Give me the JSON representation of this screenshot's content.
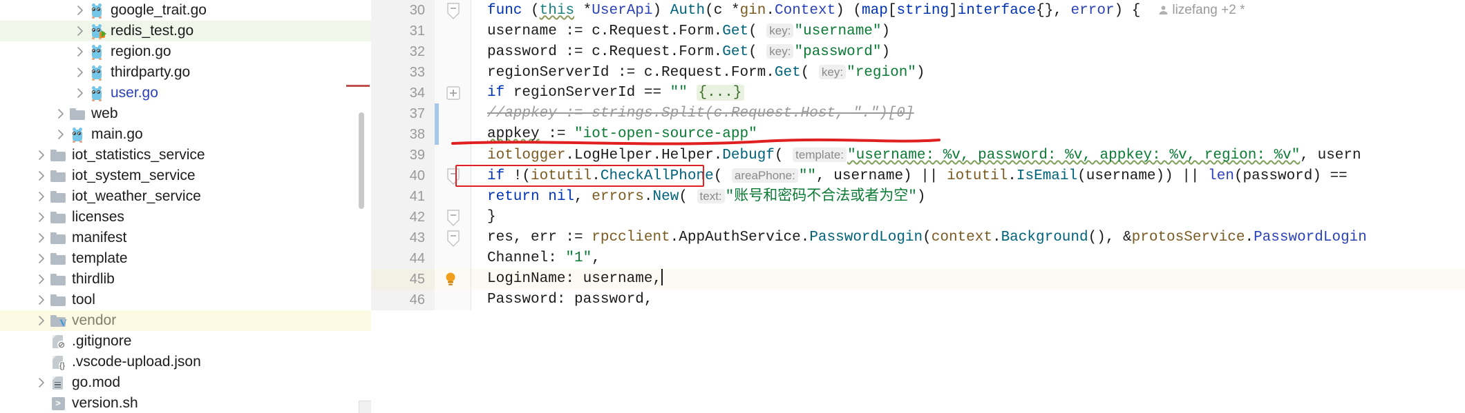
{
  "app": {
    "kind": "goland-ide-code-editor"
  },
  "sidebar": {
    "name": "project-file-tree",
    "scrollbar": {
      "name": "vertical-scrollbar"
    },
    "items": [
      {
        "label": "google_trait.go",
        "icon": "go-file-icon",
        "indent": 3,
        "arrow": true,
        "state": "normal"
      },
      {
        "label": "redis_test.go",
        "icon": "go-test-file-icon",
        "indent": 3,
        "arrow": true,
        "state": "highlight-green"
      },
      {
        "label": "region.go",
        "icon": "go-file-icon",
        "indent": 3,
        "arrow": true,
        "state": "normal"
      },
      {
        "label": "thirdparty.go",
        "icon": "go-file-icon",
        "indent": 3,
        "arrow": true,
        "state": "normal"
      },
      {
        "label": "user.go",
        "icon": "go-file-icon",
        "indent": 3,
        "arrow": true,
        "state": "open-file"
      },
      {
        "label": "web",
        "icon": "folder-icon",
        "indent": 2,
        "arrow": true,
        "state": "normal"
      },
      {
        "label": "main.go",
        "icon": "go-file-icon",
        "indent": 2,
        "arrow": true,
        "state": "normal"
      },
      {
        "label": "iot_statistics_service",
        "icon": "folder-icon",
        "indent": 1,
        "arrow": true,
        "state": "normal"
      },
      {
        "label": "iot_system_service",
        "icon": "folder-icon",
        "indent": 1,
        "arrow": true,
        "state": "normal"
      },
      {
        "label": "iot_weather_service",
        "icon": "folder-icon",
        "indent": 1,
        "arrow": true,
        "state": "normal"
      },
      {
        "label": "licenses",
        "icon": "folder-icon",
        "indent": 1,
        "arrow": true,
        "state": "normal"
      },
      {
        "label": "manifest",
        "icon": "folder-icon",
        "indent": 1,
        "arrow": true,
        "state": "normal"
      },
      {
        "label": "template",
        "icon": "folder-icon",
        "indent": 1,
        "arrow": true,
        "state": "normal"
      },
      {
        "label": "thirdlib",
        "icon": "folder-icon",
        "indent": 1,
        "arrow": true,
        "state": "normal"
      },
      {
        "label": "tool",
        "icon": "folder-icon",
        "indent": 1,
        "arrow": true,
        "state": "normal"
      },
      {
        "label": "vendor",
        "icon": "vendor-folder-icon",
        "indent": 1,
        "arrow": true,
        "state": "highlight-yellow"
      },
      {
        "label": ".gitignore",
        "icon": "gitignore-file-icon",
        "indent": 1,
        "arrow": false,
        "state": "normal"
      },
      {
        "label": ".vscode-upload.json",
        "icon": "json-file-icon",
        "indent": 1,
        "arrow": false,
        "state": "normal"
      },
      {
        "label": "go.mod",
        "icon": "gomod-file-icon",
        "indent": 1,
        "arrow": true,
        "state": "normal"
      },
      {
        "label": "version.sh",
        "icon": "shell-file-icon",
        "indent": 1,
        "arrow": false,
        "state": "normal"
      }
    ]
  },
  "editor": {
    "author_annotation": "lizefang +2 *",
    "cursor_line": 45,
    "lines": [
      {
        "num": "30",
        "fold": "minus",
        "change": false,
        "bulb": false
      },
      {
        "num": "31",
        "fold": null,
        "change": false,
        "bulb": false
      },
      {
        "num": "32",
        "fold": null,
        "change": false,
        "bulb": false
      },
      {
        "num": "33",
        "fold": null,
        "change": false,
        "bulb": false
      },
      {
        "num": "34",
        "fold": "plus",
        "change": false,
        "bulb": false
      },
      {
        "num": "37",
        "fold": null,
        "change": true,
        "bulb": false
      },
      {
        "num": "38",
        "fold": null,
        "change": true,
        "bulb": false
      },
      {
        "num": "39",
        "fold": null,
        "change": false,
        "bulb": false
      },
      {
        "num": "40",
        "fold": "minus",
        "change": false,
        "bulb": false
      },
      {
        "num": "41",
        "fold": null,
        "change": false,
        "bulb": false
      },
      {
        "num": "42",
        "fold": "minus",
        "change": false,
        "bulb": false
      },
      {
        "num": "43",
        "fold": "minus",
        "change": false,
        "bulb": false
      },
      {
        "num": "44",
        "fold": null,
        "change": false,
        "bulb": false
      },
      {
        "num": "45",
        "fold": null,
        "change": false,
        "bulb": true
      },
      {
        "num": "46",
        "fold": null,
        "change": false,
        "bulb": false
      }
    ],
    "code": {
      "l30": "func (this *UserApi) Auth(c *gin.Context) (map[string]interface{}, error) {",
      "l31": "    username := c.Request.Form.Get( key: \"username\")",
      "l32": "    password := c.Request.Form.Get( key: \"password\")",
      "l33": "    regionServerId := c.Request.Form.Get( key: \"region\")",
      "l34": "    if regionServerId == \"\" {...}",
      "l37": "    //appkey := strings.Split(c.Request.Host, \".\")[0]",
      "l38": "    appkey := \"iot-open-source-app\"",
      "l39": "    iotlogger.LogHelper.Helper.Debugf( template: \"username: %v, password: %v, appkey: %v, region: %v\", usern",
      "l40": "    if !(iotutil.CheckAllPhone( areaPhone: \"\", username) || iotutil.IsEmail(username)) || len(password) ==",
      "l41": "        return nil, errors.New( text: \"账号和密码不合法或者为空\")",
      "l42": "    }",
      "l43": "    res, err := rpcclient.AppAuthService.PasswordLogin(context.Background(), &protosService.PasswordLogin",
      "l44": "        Channel:        \"1\",",
      "l45": "        LoginName:      username,",
      "l46": "        Password:       password,"
    },
    "tokens": {
      "l30": {
        "func": "func",
        "paren1": " (",
        "this": "this",
        "star_userapi": " *",
        "UserApi": "UserApi",
        "close1": ") ",
        "Auth": "Auth",
        "open2": "(c *",
        "gin": "gin",
        "dot": ".",
        "Context": "Context",
        "close2": ") (",
        "map": "map",
        "bracket": "[",
        "string": "string",
        "bracket2": "]",
        "interface": "interface",
        "braces": "{}",
        "comma": ", ",
        "error": "error",
        "tail": ") {"
      },
      "l31": {
        "var": "    username := c.Request.Form.",
        "get": "Get",
        "lp": "( ",
        "hint": "key:",
        "val": "\"username\"",
        "rp": ")"
      },
      "l32": {
        "var": "    password := c.Request.Form.",
        "get": "Get",
        "lp": "( ",
        "hint": "key:",
        "val": "\"password\"",
        "rp": ")"
      },
      "l33": {
        "var": "    regionServerId := c.Request.Form.",
        "get": "Get",
        "lp": "( ",
        "hint": "key:",
        "val": "\"region\"",
        "rp": ")"
      },
      "l34": {
        "if": "if",
        "cond": " regionServerId == ",
        "empty": "\"\"",
        "sp": " ",
        "fold": "{...}"
      },
      "l37": {
        "comment": "//appkey := strings.Split(c.Request.Host, \".\")[0]"
      },
      "l38": {
        "name": "appkey",
        "assign": " := ",
        "value": "\"iot-open-source-app\""
      },
      "l39": {
        "pkg": "iotlogger",
        "d1": ".",
        "loghelper": "LogHelper",
        "d2": ".",
        "helper": "Helper",
        "d3": ".",
        "debugf": "Debugf",
        "lp": "( ",
        "hint": "template:",
        "str": "\"username: %v, password: %v, appkey: %v, region: %v\"",
        "tail": ", usern"
      },
      "l40": {
        "if": "if",
        "bang": " !(",
        "pkg": "iotutil",
        "d": ".",
        "fn": "CheckAllPhone",
        "lp": "( ",
        "hint": "areaPhone:",
        "empty": "\"\"",
        "mid": ", username) || ",
        "pkg2": "iotutil",
        "d2": ".",
        "fn2": "IsEmail",
        "args2": "(username)) || ",
        "len": "len",
        "tail": "(password) =="
      },
      "l41": {
        "ret": "return",
        "nil": " nil",
        "comma": ", ",
        "errors": "errors",
        "d": ".",
        "new": "New",
        "lp": "( ",
        "hint": "text:",
        "str": "\"账号和密码不合法或者为空\"",
        "rp": ")"
      },
      "l42": {
        "brace": "}"
      },
      "l43": {
        "lhs": "res, err := ",
        "pkg": "rpcclient",
        "d1": ".",
        "svc": "AppAuthService",
        "d2": ".",
        "fn": "PasswordLogin",
        "lp": "(",
        "ctx": "context",
        "d3": ".",
        "bg": "Background",
        "mid": "(), &",
        "pkg2": "protosService",
        "d4": ".",
        "type2": "PasswordLogin"
      },
      "l44": {
        "key": "        Channel:        ",
        "val": "\"1\"",
        "comma": ","
      },
      "l45": {
        "key": "        LoginName:      ",
        "val": "username",
        "comma": ","
      },
      "l46": {
        "key": "        Password:       ",
        "val": "password",
        "comma": ","
      }
    },
    "annotations": {
      "strike_color": "#e02020",
      "box_color": "#e02020",
      "strike_target_line": "37",
      "box_target_line": "38"
    }
  }
}
